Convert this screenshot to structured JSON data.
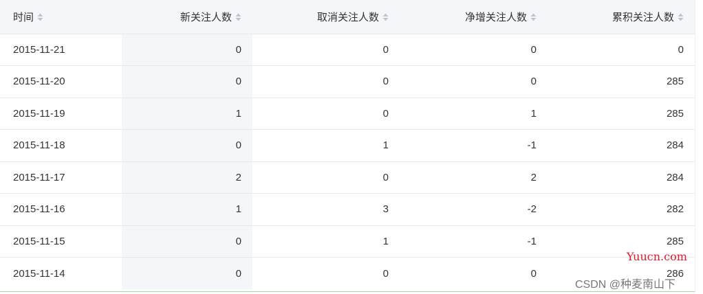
{
  "table": {
    "columns": [
      {
        "label": "时间",
        "align": "left"
      },
      {
        "label": "新关注人数",
        "align": "right"
      },
      {
        "label": "取消关注人数",
        "align": "right"
      },
      {
        "label": "净增关注人数",
        "align": "right"
      },
      {
        "label": "累积关注人数",
        "align": "right"
      }
    ],
    "highlight_color": "#f5f6f9",
    "rows": [
      [
        "2015-11-21",
        "0",
        "0",
        "0",
        "0"
      ],
      [
        "2015-11-20",
        "0",
        "0",
        "0",
        "285"
      ],
      [
        "2015-11-19",
        "1",
        "0",
        "1",
        "285"
      ],
      [
        "2015-11-18",
        "0",
        "1",
        "-1",
        "284"
      ],
      [
        "2015-11-17",
        "2",
        "0",
        "2",
        "284"
      ],
      [
        "2015-11-16",
        "1",
        "3",
        "-2",
        "282"
      ],
      [
        "2015-11-15",
        "0",
        "1",
        "-1",
        "285"
      ],
      [
        "2015-11-14",
        "0",
        "0",
        "0",
        "286"
      ]
    ]
  },
  "watermarks": {
    "site": "Yuucn.com",
    "csdn": "CSDN @种麦南山下",
    "site_color": "#e3162c"
  },
  "icons": {
    "sort": "sort-updown-icon"
  }
}
